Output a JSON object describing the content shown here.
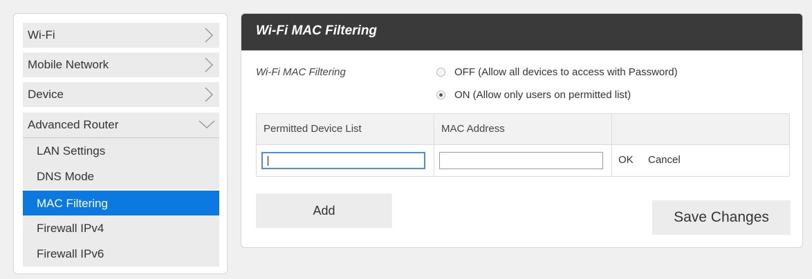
{
  "sidebar": {
    "items": [
      {
        "label": "Wi-Fi"
      },
      {
        "label": "Mobile Network"
      },
      {
        "label": "Device"
      },
      {
        "label": "Advanced Router"
      }
    ],
    "subitems": [
      {
        "label": "LAN Settings"
      },
      {
        "label": "DNS Mode"
      },
      {
        "label": "MAC Filtering"
      },
      {
        "label": "Firewall IPv4"
      },
      {
        "label": "Firewall IPv6"
      }
    ],
    "active_subitem": "MAC Filtering",
    "active_color": "#0b79e0"
  },
  "panel": {
    "title": "Wi-Fi MAC Filtering",
    "field_label": "Wi-Fi MAC Filtering",
    "options": [
      {
        "label": "OFF (Allow all devices to access with Password)",
        "checked": false
      },
      {
        "label": "ON (Allow only users on permitted list)",
        "checked": true
      }
    ],
    "table": {
      "headers": [
        "Permitted Device List",
        "MAC Address",
        ""
      ],
      "row": {
        "device_name_value": "",
        "mac_value": "",
        "ok_label": "OK",
        "cancel_label": "Cancel"
      }
    },
    "add_label": "Add",
    "save_label": "Save Changes"
  },
  "icons": {
    "collapsed": "chevron-right-icon",
    "expanded": "chevron-down-icon"
  }
}
